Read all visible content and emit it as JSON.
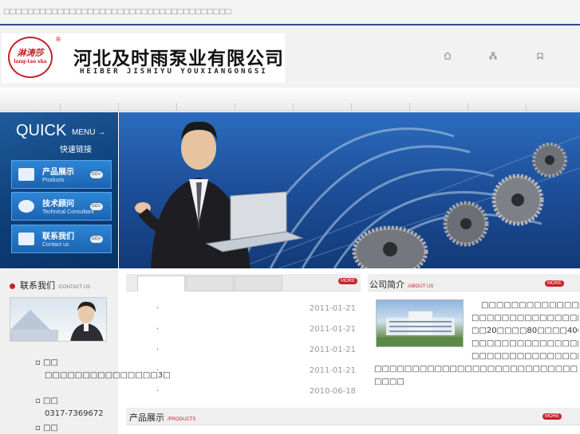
{
  "top": {
    "marquee": "□□□□□□□□□□□□□□□□□□□□□□□□□□□□□□□□□□□□□□"
  },
  "header": {
    "logo_seal_text": "淋涛莎",
    "logo_pinyin": "lang-tao sha",
    "registered_mark": "®",
    "company_cn": "河北及时雨泵业有限公司",
    "company_en": "HEIBER JISHIYU YOUXIANGONGSI",
    "icons": [
      "home-icon",
      "sitemap-icon",
      "bookmark-icon"
    ]
  },
  "quick_menu": {
    "title": "QUICK",
    "menu": "MENU →",
    "subtitle": "快速链接",
    "items": [
      {
        "cn": "产品展示",
        "en": "Products",
        "go": "GO>",
        "icon": "products-icon"
      },
      {
        "cn": "技术顾问",
        "en": "Technical Consultant",
        "go": "GO>",
        "icon": "consultant-icon"
      },
      {
        "cn": "联系我们",
        "en": "Contact us",
        "go": "GO>",
        "icon": "mail-icon"
      }
    ]
  },
  "contact": {
    "title": "联系我们",
    "title_en": "/CONTACT US",
    "address_label": "□□",
    "address": "□□□□□□□□□□□□□□□3□",
    "phone_label": "□□",
    "phone": "0317-7369672",
    "fax_label": "□□"
  },
  "news": {
    "more": "MORE",
    "items": [
      {
        "bullet": "·",
        "date": "2011-01-21"
      },
      {
        "bullet": "·",
        "date": "2011-01-21"
      },
      {
        "bullet": "·",
        "date": "2011-01-21"
      },
      {
        "bullet": "·",
        "date": "2011-01-21"
      },
      {
        "bullet": "·",
        "date": "2010-06-18"
      }
    ]
  },
  "about": {
    "title": "公司简介",
    "title_en": "/ABOUT US",
    "more": "MORE",
    "line1": "□□□□□□□□□□□□□□□□□□□□□",
    "line2": "□□□□□□□□□□□□□□□□□□□□□",
    "line3": "□□20□□□□80□□□□400□□□□□",
    "line4": "□□□□□□□□□□□□□□□□□□□□□",
    "line5": "□□□□□□□□□□□□□□□□□□□□□",
    "line6": "□□□□□□□□□□□□□□□□□□□□□□□□□□□□□□□□□□□□",
    "line7": "□□□□"
  },
  "products": {
    "title": "产品展示",
    "title_en": "/PRODUCTS",
    "more": "MORE"
  },
  "colors": {
    "brand_red": "#c8202a",
    "nav_blue": "#2a4f86",
    "quick_blue": "#0d3e78"
  }
}
